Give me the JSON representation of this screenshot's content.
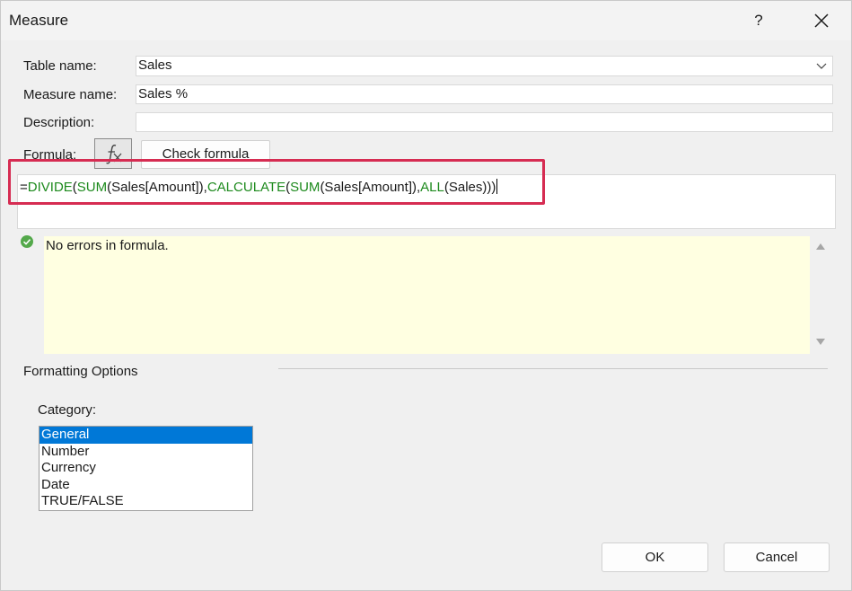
{
  "window": {
    "title": "Measure",
    "help_label": "?"
  },
  "form": {
    "table_name_label": "Table name:",
    "table_name_value": "Sales",
    "measure_name_label": "Measure name:",
    "measure_name_value": "Sales %",
    "description_label": "Description:",
    "description_value": "",
    "formula_label": "Formula:",
    "check_formula_label": "Check formula"
  },
  "formula": {
    "tokens": [
      {
        "text": "=",
        "kind": "plain"
      },
      {
        "text": "DIVIDE",
        "kind": "kw"
      },
      {
        "text": "(",
        "kind": "plain"
      },
      {
        "text": "SUM",
        "kind": "kw"
      },
      {
        "text": "(Sales[Amount]),",
        "kind": "plain"
      },
      {
        "text": "CALCULATE",
        "kind": "kw"
      },
      {
        "text": "(",
        "kind": "plain"
      },
      {
        "text": "SUM",
        "kind": "kw"
      },
      {
        "text": "(Sales[Amount]),",
        "kind": "plain"
      },
      {
        "text": "ALL",
        "kind": "kw"
      },
      {
        "text": "(Sales)))",
        "kind": "plain"
      }
    ]
  },
  "status": {
    "message": "No errors in formula."
  },
  "formatting": {
    "section_label": "Formatting Options",
    "category_label": "Category:",
    "categories": [
      "General",
      "Number",
      "Currency",
      "Date",
      "TRUE/FALSE"
    ],
    "selected_index": 0
  },
  "buttons": {
    "ok": "OK",
    "cancel": "Cancel"
  },
  "colors": {
    "keyword": "#1d8a1d",
    "highlight": "#d62c52",
    "selection": "#0078d7",
    "status_bg": "#ffffe1"
  }
}
